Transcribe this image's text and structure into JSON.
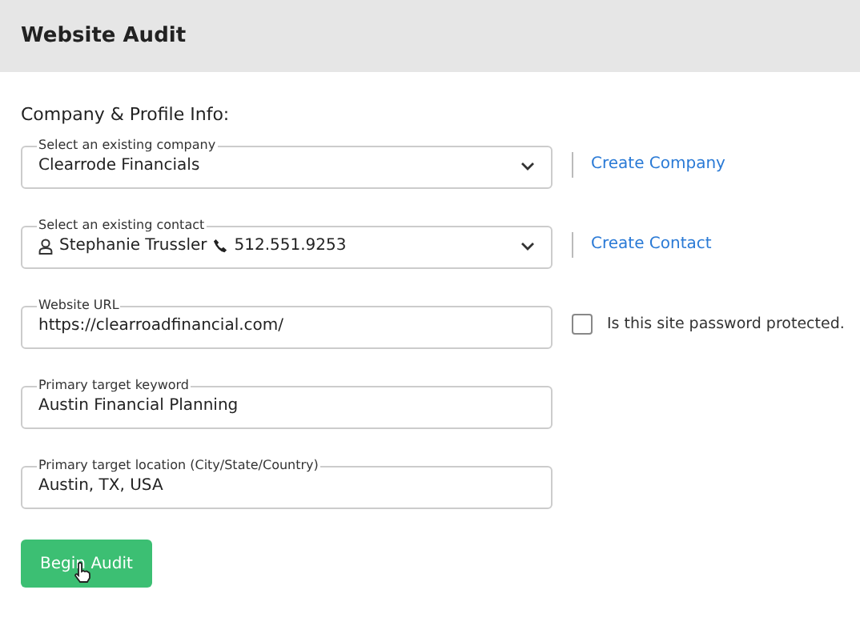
{
  "header": {
    "title": "Website Audit"
  },
  "section": {
    "title": "Company & Profile Info:"
  },
  "fields": [
    {
      "kind": "select",
      "label": "Select an existing company",
      "value": "Clearrode Financials",
      "side": {
        "kind": "link",
        "text": "Create Company"
      }
    },
    {
      "kind": "contact",
      "label": "Select an existing contact",
      "name": "Stephanie Trussler",
      "phone": "512.551.9253",
      "side": {
        "kind": "link",
        "text": "Create Contact"
      }
    },
    {
      "kind": "input",
      "label": "Website URL",
      "value": "https://clearroadfinancial.com/",
      "side": {
        "kind": "checkbox",
        "text": "Is this site password protected.",
        "checked": false
      }
    },
    {
      "kind": "input",
      "label": "Primary target keyword",
      "value": "Austin Financial Planning"
    },
    {
      "kind": "input",
      "label": "Primary target location (City/State/Country)",
      "value": "Austin, TX, USA"
    }
  ],
  "button": {
    "label": "Begin Audit"
  }
}
